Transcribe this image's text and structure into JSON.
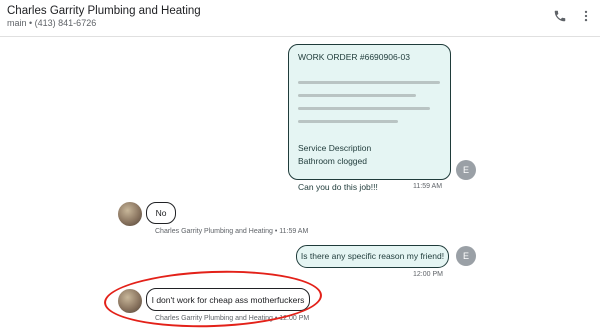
{
  "header": {
    "title": "Charles Garrity Plumbing and Heating",
    "subtitle": "main • (413) 841-6726",
    "phone_icon": "phone-icon",
    "more_icon": "more-vert-icon"
  },
  "messages": {
    "work_order": {
      "line1": "WORK ORDER #6690906-03",
      "service_label": "Service Description",
      "service_value": "Bathroom clogged",
      "request": "Can you do this job!!!",
      "time": "11:59 AM",
      "avatar": "E"
    },
    "reply1": {
      "text": "No",
      "meta": "Charles Garrity Plumbing and Heating • 11:59 AM"
    },
    "question": {
      "text": "Is there any specific reason my friend!",
      "time": "12:00 PM",
      "avatar": "E"
    },
    "reply2": {
      "text": "I don't work for cheap ass motherfuckers",
      "meta": "Charles Garrity Plumbing and Heating • 12:00 PM"
    }
  },
  "colors": {
    "outgoing_bubble": "#e5f5f3",
    "outgoing_border": "#1f3b3a",
    "annotation": "#e32119"
  }
}
